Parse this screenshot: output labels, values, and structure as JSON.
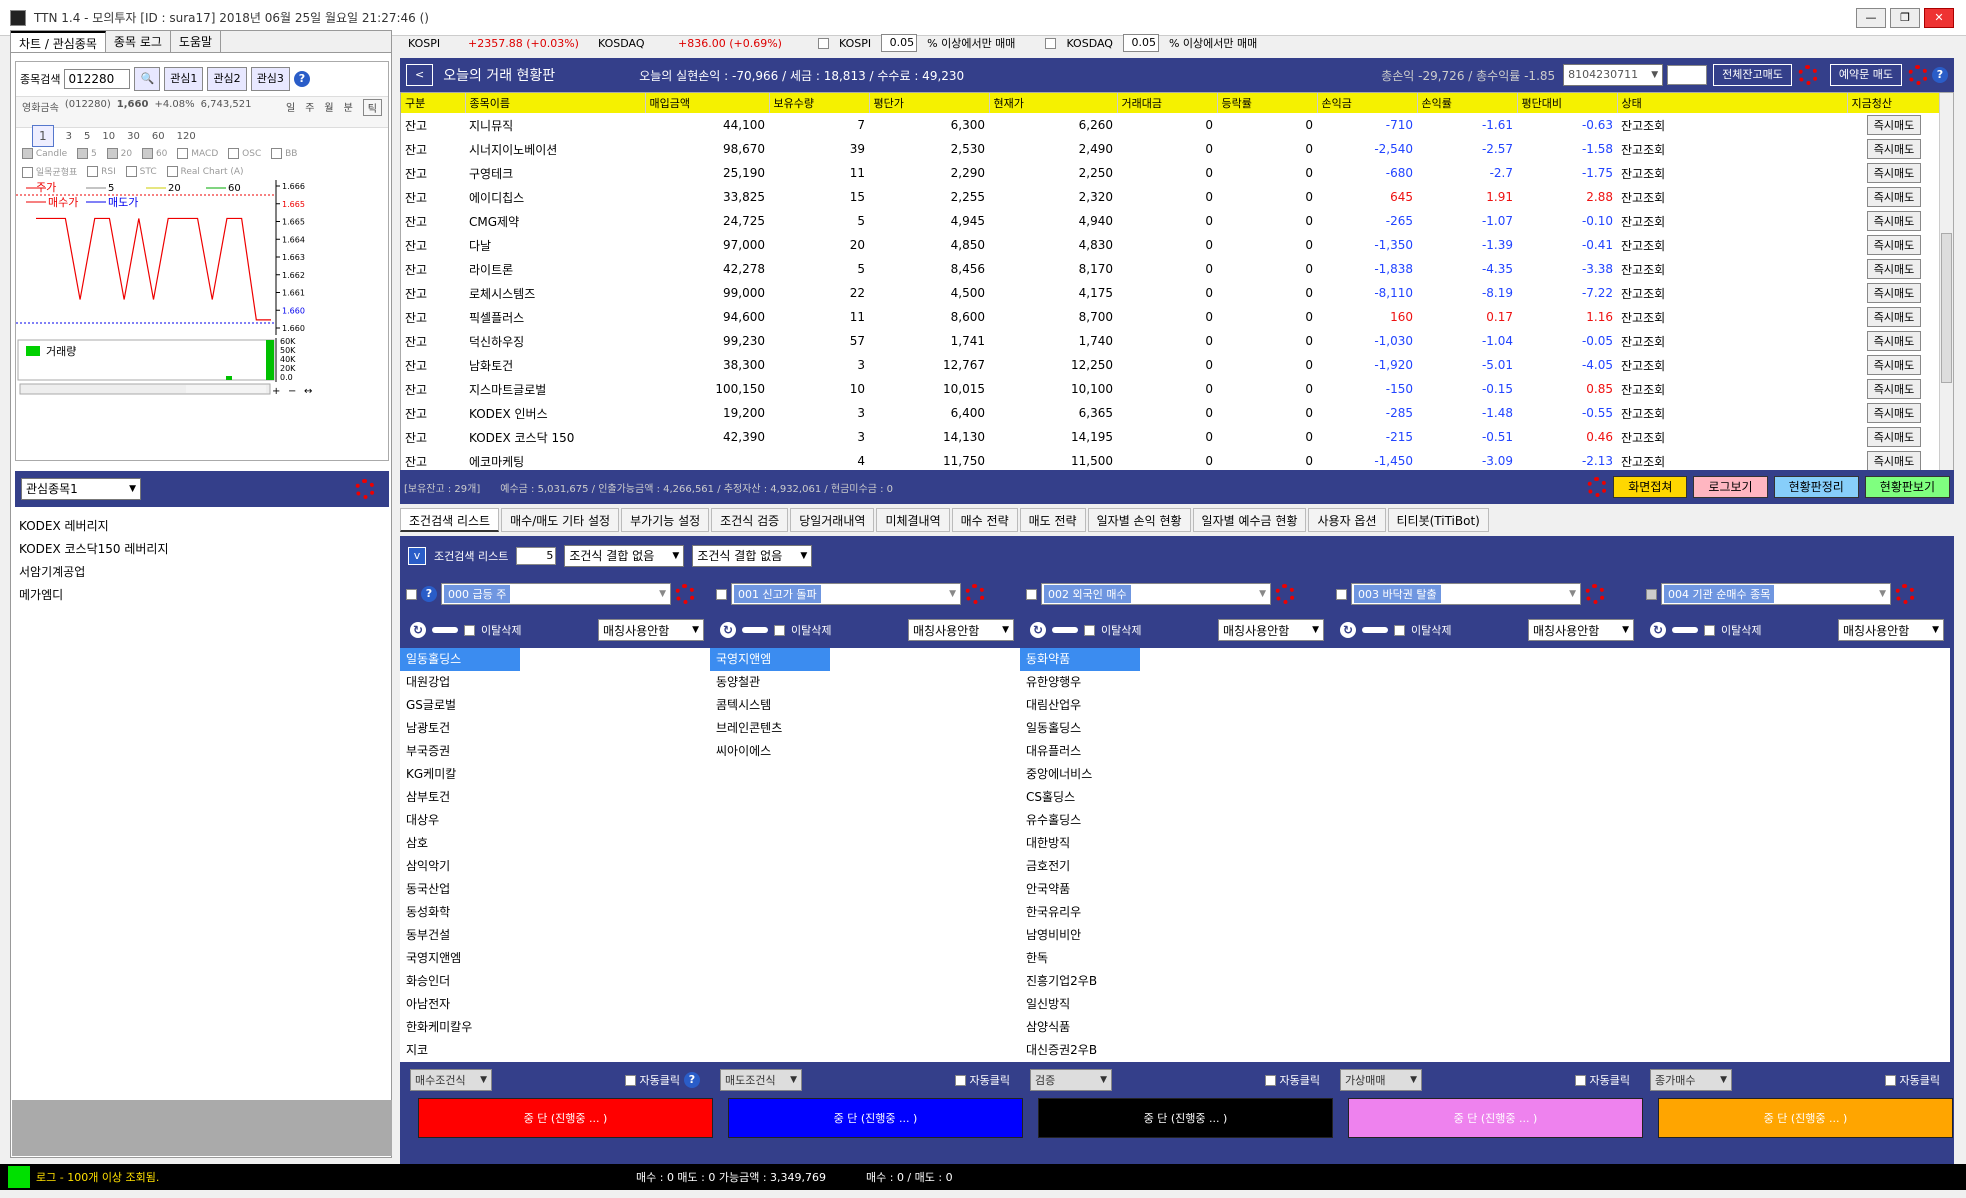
{
  "window": {
    "title": "TTN 1.4 - 모의투자 [ID : sura17] 2018년 06월 25일 월요일 21:27:46 ()"
  },
  "left": {
    "tabs": [
      "차트 / 관심종목",
      "종목 로그",
      "도움말"
    ],
    "search_label": "종목검색",
    "search_value": "012280",
    "watch_buttons": [
      "관심1",
      "관심2",
      "관심3"
    ],
    "info_name": "영화금속",
    "info_code": "(012280)",
    "info_price": "1,660",
    "info_change": "+4.08%",
    "info_volume": "6,743,521",
    "periods": [
      "일",
      "주",
      "월",
      "분",
      "틱"
    ],
    "intervals": [
      "1",
      "3",
      "5",
      "10",
      "30",
      "60",
      "120"
    ],
    "opts1": [
      "Candle",
      "5",
      "20",
      "60",
      "MACD",
      "OSC",
      "BB"
    ],
    "opts2": [
      "일목균형표",
      "RSI",
      "STC",
      "Real Chart (A)"
    ],
    "legend": [
      "주가",
      "5",
      "20",
      "60"
    ],
    "buy_label": "매수가",
    "sell_label": "매도가",
    "yticks": [
      "1.666",
      "1.665",
      "1.665",
      "1.664",
      "1.663",
      "1.662",
      "1.661",
      "1.660",
      "1.660"
    ],
    "volume_label": "거래량",
    "vol_ticks": [
      "60K",
      "50K",
      "40K",
      "20K",
      "0.0"
    ],
    "chart_data": {
      "type": "line",
      "series": [
        {
          "name": "매수가",
          "values": [
            1665,
            1665,
            1665,
            1661,
            1665,
            1665,
            1661,
            1665,
            1661,
            1665,
            1665,
            1665,
            1661,
            1665,
            1665,
            1660,
            1660
          ]
        }
      ]
    },
    "interest_select": "관심종목1",
    "interest_items": [
      "KODEX 레버리지",
      "KODEX 코스닥150 레버리지",
      "서암기계공업",
      "메가엠디"
    ]
  },
  "index": {
    "kospi_label": "KOSPI",
    "kospi_val": "+2357.88 (+0.03%)",
    "kosdaq_label": "KOSDAQ",
    "kosdaq_val": "+836.00 (+0.69%)",
    "cb1": "KOSPI",
    "pct1": "0.05",
    "txt1": "% 이상에서만 매매",
    "cb2": "KOSDAQ",
    "pct2": "0.05",
    "txt2": "% 이상에서만 매매"
  },
  "header": {
    "back": "<",
    "title": "오늘의 거래 현황판",
    "summary": "오늘의 실현손익 : -70,966 / 세금 : 18,813 / 수수료 : 49,230",
    "total": "총손익 -29,726 / 총수익률 -1.85",
    "account": "8104230711",
    "pw": "****",
    "btn_all": "전체잔고매도",
    "btn_reserve": "예약문 매도"
  },
  "grid": {
    "columns": [
      "구분",
      "종목이름",
      "매입금액",
      "보유수량",
      "평단가",
      "현재가",
      "거래대금",
      "등락률",
      "손익금",
      "손익률",
      "평단대비",
      "상태",
      "지금청산"
    ],
    "rows": [
      [
        "잔고",
        "지니뮤직",
        "44,100",
        "7",
        "6,300",
        "6,260",
        "0",
        "0",
        "-710",
        "-1.61",
        "-0.63",
        "잔고조회"
      ],
      [
        "잔고",
        "시너지이노베이션",
        "98,670",
        "39",
        "2,530",
        "2,490",
        "0",
        "0",
        "-2,540",
        "-2.57",
        "-1.58",
        "잔고조회"
      ],
      [
        "잔고",
        "구영테크",
        "25,190",
        "11",
        "2,290",
        "2,250",
        "0",
        "0",
        "-680",
        "-2.7",
        "-1.75",
        "잔고조회"
      ],
      [
        "잔고",
        "에이디칩스",
        "33,825",
        "15",
        "2,255",
        "2,320",
        "0",
        "0",
        "645",
        "1.91",
        "2.88",
        "잔고조회"
      ],
      [
        "잔고",
        "CMG제약",
        "24,725",
        "5",
        "4,945",
        "4,940",
        "0",
        "0",
        "-265",
        "-1.07",
        "-0.10",
        "잔고조회"
      ],
      [
        "잔고",
        "다날",
        "97,000",
        "20",
        "4,850",
        "4,830",
        "0",
        "0",
        "-1,350",
        "-1.39",
        "-0.41",
        "잔고조회"
      ],
      [
        "잔고",
        "라이트론",
        "42,278",
        "5",
        "8,456",
        "8,170",
        "0",
        "0",
        "-1,838",
        "-4.35",
        "-3.38",
        "잔고조회"
      ],
      [
        "잔고",
        "로체시스템즈",
        "99,000",
        "22",
        "4,500",
        "4,175",
        "0",
        "0",
        "-8,110",
        "-8.19",
        "-7.22",
        "잔고조회"
      ],
      [
        "잔고",
        "픽셀플러스",
        "94,600",
        "11",
        "8,600",
        "8,700",
        "0",
        "0",
        "160",
        "0.17",
        "1.16",
        "잔고조회"
      ],
      [
        "잔고",
        "덕신하우징",
        "99,230",
        "57",
        "1,741",
        "1,740",
        "0",
        "0",
        "-1,030",
        "-1.04",
        "-0.05",
        "잔고조회"
      ],
      [
        "잔고",
        "남화토건",
        "38,300",
        "3",
        "12,767",
        "12,250",
        "0",
        "0",
        "-1,920",
        "-5.01",
        "-4.05",
        "잔고조회"
      ],
      [
        "잔고",
        "지스마트글로벌",
        "100,150",
        "10",
        "10,015",
        "10,100",
        "0",
        "0",
        "-150",
        "-0.15",
        "0.85",
        "잔고조회"
      ],
      [
        "잔고",
        "KODEX 인버스",
        "19,200",
        "3",
        "6,400",
        "6,365",
        "0",
        "0",
        "-285",
        "-1.48",
        "-0.55",
        "잔고조회"
      ],
      [
        "잔고",
        "KODEX 코스닥 150",
        "42,390",
        "3",
        "14,130",
        "14,195",
        "0",
        "0",
        "-215",
        "-0.51",
        "0.46",
        "잔고조회"
      ],
      [
        "잔고",
        "에코마케팅",
        "",
        "4",
        "11,750",
        "11,500",
        "0",
        "0",
        "-1,450",
        "-3.09",
        "-2.13",
        "잔고조회"
      ]
    ],
    "sell_label": "즉시매도"
  },
  "status": {
    "holdings": "[보유잔고 : 29개]",
    "detail": "예수금 : 5,031,675 / 인출가능금액 : 4,266,561 / 추정자산 : 4,932,061 / 현금미수금 : 0",
    "b1": "화면접쳐",
    "b2": "로그보기",
    "b3": "현황판정리",
    "b4": "현황판보기"
  },
  "tabs2": [
    "조건검색 리스트",
    "매수/매도 기타 설정",
    "부가기능 설정",
    "조건식 검증",
    "당일거래내역",
    "미체결내역",
    "매수 전략",
    "매도 전략",
    "일자별 손익 현황",
    "일자별 예수금 현황",
    "사용자 옵션",
    "티티봇(TiTiBot)"
  ],
  "cond": {
    "label": "조건검색 리스트",
    "count": "5",
    "combine1": "조건식 결합 없음",
    "combine2": "조건식 결합 없음",
    "names": [
      "000 급등 주",
      "001 신고가 돌파",
      "002 외국인 매수",
      "003 바닥권 탈출",
      "004 기관 순매수 종목"
    ],
    "remove": "이탈삭제",
    "match": "매칭사용안함",
    "auto": "자동클릭",
    "bottom_sel": [
      "매수조건식",
      "매도조건식",
      "검증",
      "가상매매",
      "종가매수"
    ],
    "run": "중 단 (진행중 ... )",
    "run_colors": [
      "#ff0000",
      "#0000ff",
      "#000000",
      "#ee82ee",
      "#ffa500"
    ],
    "lists": [
      [
        "일동홀딩스",
        "대원강업",
        "GS글로벌",
        "남광토건",
        "부국증권",
        "KG케미칼",
        "삼부토건",
        "대상우",
        "삼호",
        "삼익악기",
        "동국산업",
        "동성화학",
        "동부건설",
        "국영지앤엠",
        "화승인더",
        "아남전자",
        "한화케미칼우",
        "지코"
      ],
      [
        "국영지앤엠",
        "동양철관",
        "콤텍시스템",
        "브레인콘텐츠",
        "씨아이에스"
      ],
      [
        "동화약품",
        "유한양행우",
        "대림산업우",
        "일동홀딩스",
        "대유플러스",
        "중앙에너비스",
        "CS홀딩스",
        "유수홀딩스",
        "대한방직",
        "금호전기",
        "안국약품",
        "한국유리우",
        "남영비비안",
        "한독",
        "진흥기업2우B",
        "일신방직",
        "삼양식품",
        "대신증권2우B"
      ],
      [],
      []
    ]
  },
  "footer": {
    "log": "로그 - 100개 이상 조회됨.",
    "counts": "매수 : 0 매도 : 0 가능금액 : 3,349,769",
    "counts2": "매수 : 0 / 매도 : 0"
  }
}
